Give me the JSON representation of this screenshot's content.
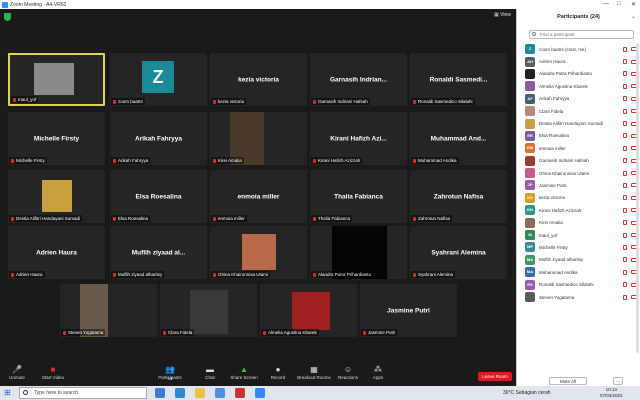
{
  "window": {
    "title": "Zoom Meeting - A4-VR62",
    "minimize": "—",
    "maximize": "□",
    "close": "✕"
  },
  "stage": {
    "view_label": "View"
  },
  "tiles": [
    {
      "tag": "maul_yof",
      "big": ""
    },
    {
      "tag": "zoom baa04",
      "big": "",
      "avatar": "Z"
    },
    {
      "tag": "kezia victoria",
      "big": "kezia victoria"
    },
    {
      "tag": "Garnasih Indriani Hafsah",
      "big": "Garnasih Indrian..."
    },
    {
      "tag": "Ronaldi Sasmedico Silalahi",
      "big": "Ronaldi Sasmedi..."
    },
    {
      "tag": "Michelle Firsty",
      "big": "Michelle Firsty"
    },
    {
      "tag": "Arikah Fahryya",
      "big": "Arikah Fahryya"
    },
    {
      "tag": "Kirei Amalia",
      "big": ""
    },
    {
      "tag": "Kirani Hafizh Azizzah",
      "big": "Kirani Hafizh Azi..."
    },
    {
      "tag": "Muhammad Andika",
      "big": "Muhammad And..."
    },
    {
      "tag": "Destia Alifitri Handayani Sumadi",
      "big": ""
    },
    {
      "tag": "Elsa Roesalina",
      "big": "Elsa Roesalina"
    },
    {
      "tag": "enmoia miller",
      "big": "enmoia miller"
    },
    {
      "tag": "Thalia Fabianca",
      "big": "Thalia Fabianca"
    },
    {
      "tag": "Zahrotun Nafisa",
      "big": "Zahrotun Nafisa"
    },
    {
      "tag": "Adrien Haura",
      "big": "Adrien Haura"
    },
    {
      "tag": "Muflih ziyaad alharitsy",
      "big": "Muflih ziyaad al..."
    },
    {
      "tag": "Ghina Khairunnisa Utami",
      "big": ""
    },
    {
      "tag": "Alandra Putra Prihardianto",
      "big": ""
    },
    {
      "tag": "Syahrani Alemina",
      "big": "Syahrani Alemina"
    },
    {
      "tag": "Steven Yogatama",
      "big": ""
    },
    {
      "tag": "Clara Fidela",
      "big": ""
    },
    {
      "tag": "Almelia Agustina Kbarek",
      "big": ""
    },
    {
      "tag": "Jasmine Putri",
      "big": "Jasmine Putri"
    }
  ],
  "toolbar": {
    "unmute": "Unmute",
    "start_video": "Start Video",
    "participants": "Participants",
    "participants_count": "24",
    "chat": "Chat",
    "share_screen": "Share Screen",
    "record": "Record",
    "breakout_rooms": "Breakout Rooms",
    "reactions": "Reactions",
    "apps": "Apps",
    "leave_room": "Leave Room"
  },
  "panel": {
    "title": "Participants (24)",
    "search_placeholder": "Find a participant",
    "mute_all": "Mute All",
    "more": "...",
    "participants": [
      {
        "initials": "Z",
        "name": "zoom baa04 (Host, me)",
        "color": "#1a8a9a"
      },
      {
        "initials": "AH",
        "name": "Adrien Haura",
        "color": "#555d66"
      },
      {
        "initials": "",
        "name": "Alandra Putra Prihardianto",
        "color": "#222222"
      },
      {
        "initials": "",
        "name": "Almelia Agustina Kbarek",
        "color": "#8b5a9b"
      },
      {
        "initials": "AF",
        "name": "Arikah Fahryya",
        "color": "#4a5d6e"
      },
      {
        "initials": "",
        "name": "Clara Fidela",
        "color": "#b38a7a"
      },
      {
        "initials": "",
        "name": "Destia Alifitri Handayani Sumadi",
        "color": "#c8a040"
      },
      {
        "initials": "ER",
        "name": "Elsa Roesalina",
        "color": "#7b5aa8"
      },
      {
        "initials": "EM",
        "name": "enmoia miller",
        "color": "#e07030"
      },
      {
        "initials": "",
        "name": "Garnasih Indriani Hafsah",
        "color": "#9a4030"
      },
      {
        "initials": "",
        "name": "Ghina Khairunnisa Utami",
        "color": "#c85a8a"
      },
      {
        "initials": "JP",
        "name": "Jasmine Putri",
        "color": "#9a5ab0"
      },
      {
        "initials": "KV",
        "name": "kezia victoria",
        "color": "#d4a020"
      },
      {
        "initials": "KH",
        "name": "Kirani Hafizh Azizzah",
        "color": "#2a9a8a"
      },
      {
        "initials": "",
        "name": "Kirei Amalia",
        "color": "#8a6a5a"
      },
      {
        "initials": "M",
        "name": "maul_yof",
        "color": "#2a8a5a"
      },
      {
        "initials": "MF",
        "name": "Michelle Firsty",
        "color": "#3a8a9a"
      },
      {
        "initials": "MA",
        "name": "Muflih ziyaad alharitsy",
        "color": "#3a9a6a"
      },
      {
        "initials": "MA",
        "name": "Muhammad Andika",
        "color": "#3a6ab0"
      },
      {
        "initials": "RS",
        "name": "Ronaldi Sasmedico Silalahi",
        "color": "#9a5ab0"
      },
      {
        "initials": "",
        "name": "Steven Yogatama",
        "color": "#5a5a5a"
      }
    ]
  },
  "taskbar": {
    "search_placeholder": "Type here to search",
    "weather": "30°C  Sebagian cerah",
    "time": "10:13",
    "date": "07/03/2022"
  }
}
